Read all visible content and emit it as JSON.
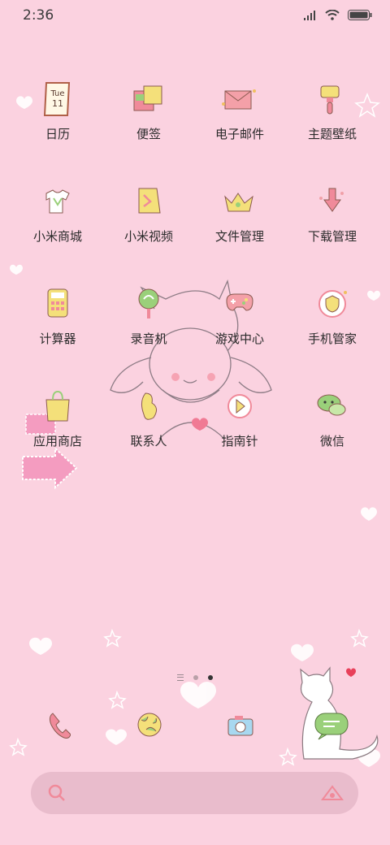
{
  "status_bar": {
    "time": "2:36",
    "icons": [
      "signal-icon",
      "wifi-icon",
      "battery-icon"
    ]
  },
  "apps": [
    {
      "label": "日历",
      "icon": "calendar-icon",
      "calendar_day": "Tue",
      "calendar_date": "11"
    },
    {
      "label": "便签",
      "icon": "notes-icon"
    },
    {
      "label": "电子邮件",
      "icon": "mail-icon"
    },
    {
      "label": "主题壁纸",
      "icon": "theme-brush-icon"
    },
    {
      "label": "小米商城",
      "icon": "shirt-store-icon"
    },
    {
      "label": "小米视频",
      "icon": "video-icon"
    },
    {
      "label": "文件管理",
      "icon": "crown-folder-icon"
    },
    {
      "label": "下载管理",
      "icon": "download-icon"
    },
    {
      "label": "计算器",
      "icon": "calculator-icon"
    },
    {
      "label": "录音机",
      "icon": "recorder-lollipop-icon"
    },
    {
      "label": "游戏中心",
      "icon": "gamepad-icon"
    },
    {
      "label": "手机管家",
      "icon": "shield-icon"
    },
    {
      "label": "应用商店",
      "icon": "shopping-bag-icon"
    },
    {
      "label": "联系人",
      "icon": "contacts-icon"
    },
    {
      "label": "指南针",
      "icon": "compass-icon"
    },
    {
      "label": "微信",
      "icon": "wechat-icon"
    }
  ],
  "page_indicator": {
    "pages": 2,
    "active": 2
  },
  "dock": [
    {
      "icon": "phone-icon"
    },
    {
      "icon": "browser-globe-icon"
    },
    {
      "icon": "camera-icon"
    },
    {
      "icon": "messages-icon"
    }
  ],
  "search_bar": {
    "left_icon": "search-icon",
    "right_icon": "assistant-icon"
  },
  "colors": {
    "background": "#fbd2e0",
    "search_bar": "#e9bccc",
    "icon_pink": "#f08a9a",
    "icon_yellow": "#f4e07a",
    "icon_green": "#9ad07a"
  }
}
